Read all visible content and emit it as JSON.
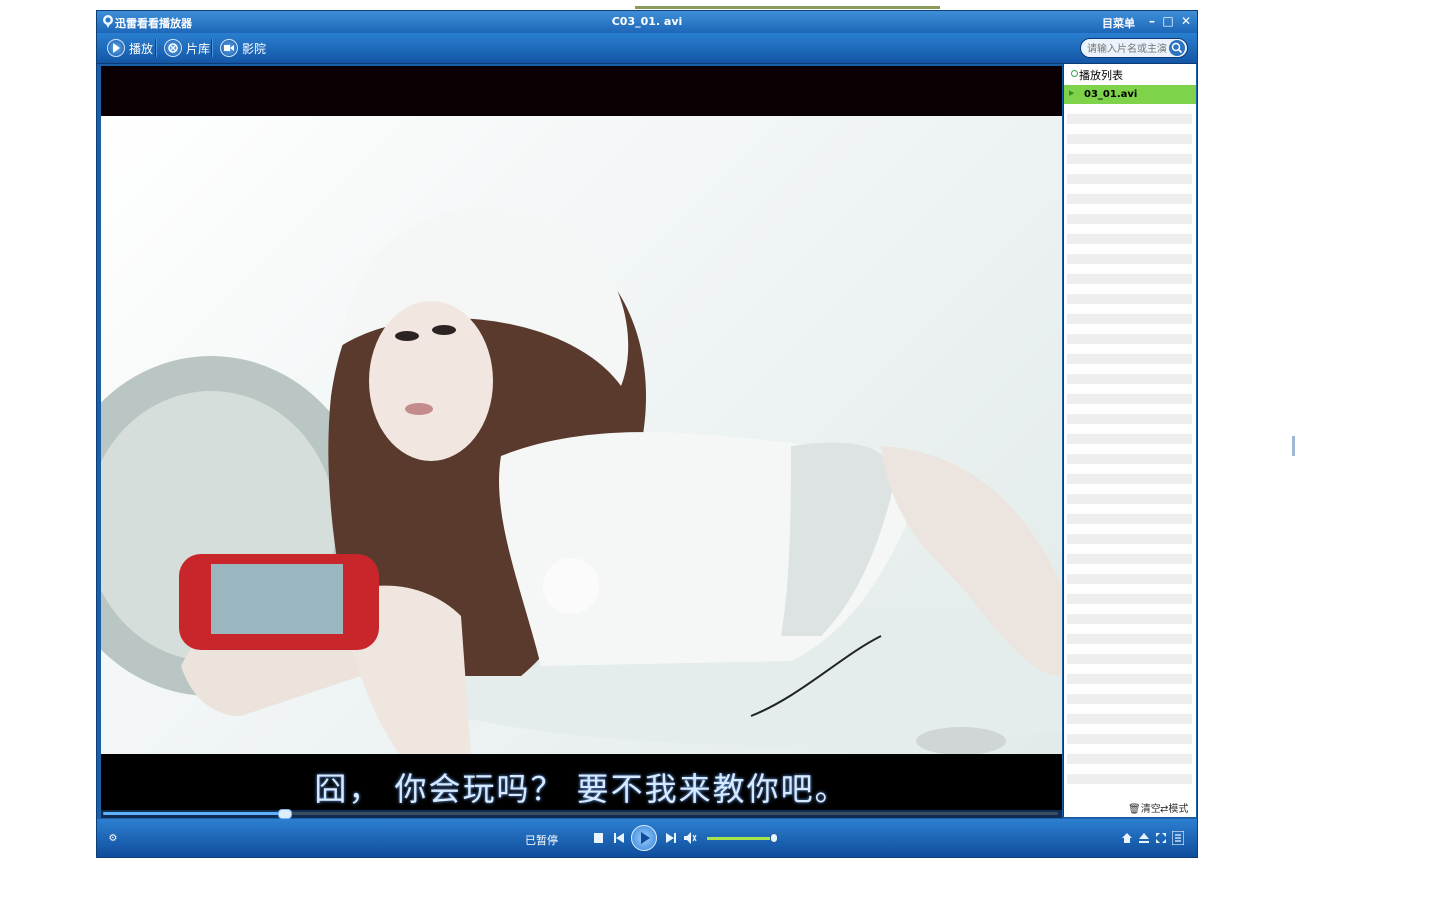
{
  "titlebar": {
    "app_title": "迅雷看看播放器",
    "file_title": "C03_01. avi",
    "menu_label": "目菜单",
    "minimize": "–",
    "maximize": "□",
    "close": "✕"
  },
  "toolbar": {
    "tabs": [
      {
        "label": "播放"
      },
      {
        "label": "片库"
      },
      {
        "label": "影院"
      }
    ],
    "search_placeholder": "请输入片名或主演"
  },
  "video": {
    "subtitle": "囧， 你会玩吗？ 要不我来教你吧。",
    "progress": 0.19
  },
  "playlist": {
    "header": "播放列表",
    "items": [
      {
        "name": "03_01.avi",
        "selected": true
      }
    ],
    "clear_label": "清空",
    "mode_label": "模式"
  },
  "controls": {
    "status": "已暂停",
    "volume": 0.95
  },
  "colors": {
    "chrome": "#1b5fa8",
    "accent_green": "#7fd34a",
    "subtitle": "#d6e9ff"
  }
}
